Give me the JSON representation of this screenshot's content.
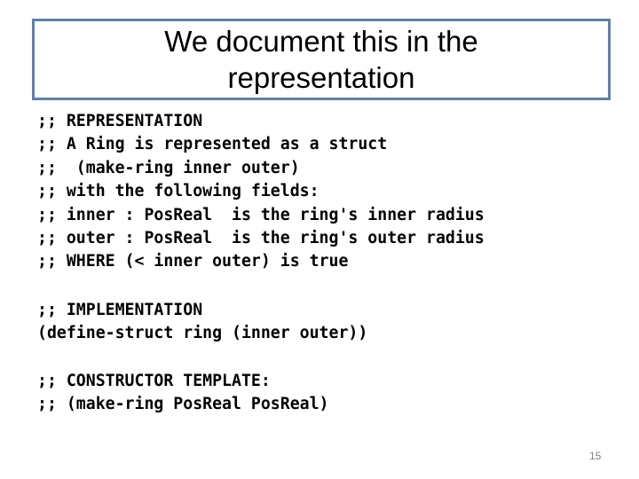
{
  "slide": {
    "title": "We document this in the representation",
    "representation_block": [
      ";; REPRESENTATION",
      ";; A Ring is represented as a struct",
      ";;  (make-ring inner outer)",
      ";; with the following fields:",
      ";; inner : PosReal  is the ring's inner radius",
      ";; outer : PosReal  is the ring's outer radius",
      ";; WHERE (< inner outer) is true"
    ],
    "implementation_block": [
      ";; IMPLEMENTATION",
      "(define-struct ring (inner outer))"
    ],
    "constructor_block": [
      ";; CONSTRUCTOR TEMPLATE:",
      ";; (make-ring PosReal PosReal)"
    ],
    "page_number": "15",
    "colors": {
      "title_border": "#5f7fa6",
      "text": "#000000",
      "page_number": "#7f7f7f"
    }
  }
}
